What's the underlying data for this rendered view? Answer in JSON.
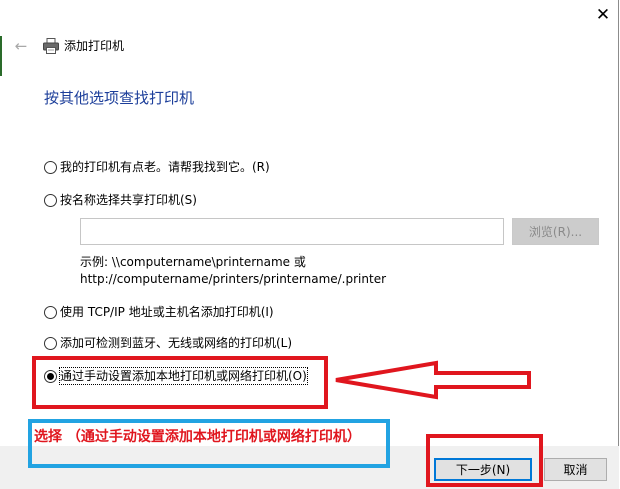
{
  "window": {
    "title": "添加打印机",
    "close_glyph": "✕",
    "back_glyph": "←"
  },
  "heading": "按其他选项查找打印机",
  "options": [
    {
      "label": "我的打印机有点老。请帮我找到它。(R)",
      "checked": false
    },
    {
      "label": "按名称选择共享打印机(S)",
      "checked": false
    },
    {
      "label": "使用 TCP/IP 地址或主机名添加打印机(I)",
      "checked": false
    },
    {
      "label": "添加可检测到蓝牙、无线或网络的打印机(L)",
      "checked": false
    },
    {
      "label": "通过手动设置添加本地打印机或网络打印机(O)",
      "checked": true
    }
  ],
  "shared_printer": {
    "input_value": "",
    "browse_label": "浏览(R)...",
    "example_line1": "示例: \\\\computername\\printername 或",
    "example_line2": "http://computername/printers/printername/.printer"
  },
  "annotation": {
    "text": "选择 （通过手动设置添加本地打印机或网络打印机）",
    "red_color": "#e0161e",
    "blue_color": "#22a3e2"
  },
  "footer": {
    "next_label": "下一步(N)",
    "cancel_label": "取消"
  },
  "colors": {
    "heading": "#1c3e9a",
    "focus_border": "#0078d7"
  }
}
